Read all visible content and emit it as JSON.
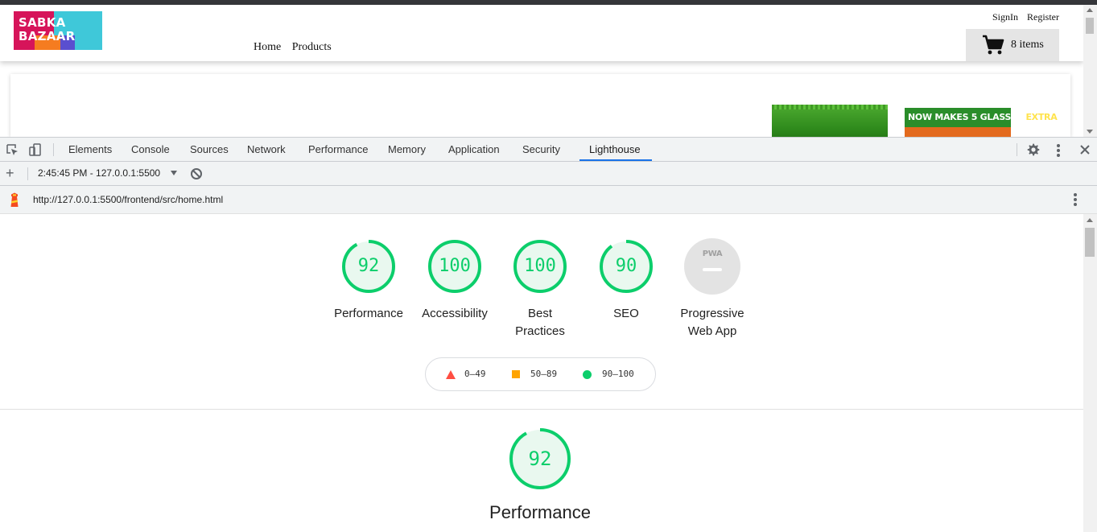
{
  "site": {
    "logo_text_line1": "SABKA",
    "logo_text_line2": "BAZAAR",
    "nav": {
      "home": "Home",
      "products": "Products"
    },
    "auth": {
      "signin": "SignIn",
      "register": "Register"
    },
    "cart": {
      "label": "8 items",
      "icon": "cart-icon"
    },
    "banner": {
      "pack_text": "NOW MAKES",
      "pack_count": "5",
      "pack_text2": "GLASSES",
      "pack_highlight": "EXTRA"
    }
  },
  "devtools": {
    "tabs": [
      "Elements",
      "Console",
      "Sources",
      "Network",
      "Performance",
      "Memory",
      "Application",
      "Security",
      "Lighthouse"
    ],
    "active_tab": "Lighthouse",
    "report_selector": "2:45:45 PM - 127.0.0.1:5500",
    "url": "http://127.0.0.1:5500/frontend/src/home.html",
    "accent": "#1a73e8"
  },
  "lighthouse": {
    "categories": [
      {
        "score": "92",
        "label": "Performance",
        "fraction": 0.92
      },
      {
        "score": "100",
        "label": "Accessibility",
        "fraction": 1.0
      },
      {
        "score": "100",
        "label": "Best Practices",
        "fraction": 1.0
      },
      {
        "score": "90",
        "label": "SEO",
        "fraction": 0.9
      }
    ],
    "pwa": {
      "badge": "PWA",
      "label_line1": "Progressive",
      "label_line2": "Web App"
    },
    "legend": {
      "fail": "0–49",
      "average": "50–89",
      "pass": "90–100"
    },
    "colors": {
      "pass": "#0cce6b",
      "average": "#ffa400",
      "fail": "#ff4e42"
    },
    "section": {
      "score": "92",
      "title": "Performance",
      "fraction": 0.92
    }
  }
}
